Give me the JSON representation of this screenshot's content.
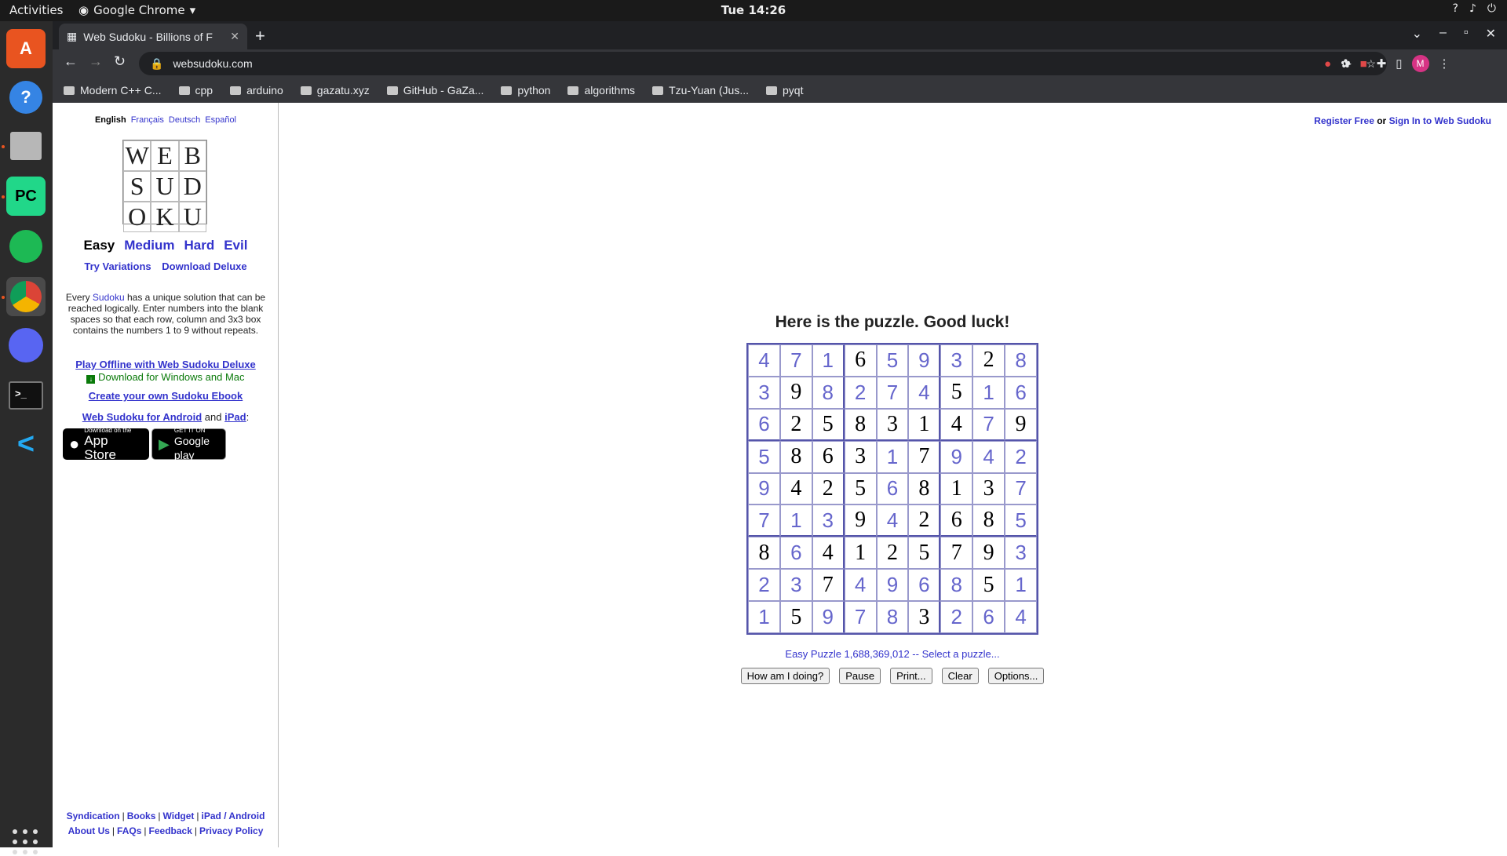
{
  "os": {
    "activities": "Activities",
    "app_menu": "Google Chrome",
    "clock": "Tue 14:26"
  },
  "browser": {
    "tab_title": "Web Sudoku - Billions of F",
    "url": "websudoku.com",
    "bookmarks": [
      "Modern C++ C...",
      "cpp",
      "arduino",
      "gazatu.xyz",
      "GitHub - GaZa...",
      "python",
      "algorithms",
      "Tzu-Yuan (Jus...",
      "pyqt"
    ],
    "profile_initial": "M"
  },
  "left": {
    "languages": [
      "English",
      "Français",
      "Deutsch",
      "Español"
    ],
    "logo_letters": [
      "W",
      "E",
      "B",
      "S",
      "U",
      "D",
      "O",
      "K",
      "U"
    ],
    "levels": [
      "Easy",
      "Medium",
      "Hard",
      "Evil"
    ],
    "try_variations": "Try Variations",
    "download_deluxe": "Download Deluxe",
    "intro_before": "Every",
    "intro_link": "Sudoku",
    "intro_after": "has a unique solution that can be reached logically. Enter numbers into the blank spaces so that each row, column and 3x3 box contains the numbers 1 to 9 without repeats.",
    "play_offline": "Play Offline with Web Sudoku Deluxe",
    "download_note": "Download for Windows and Mac",
    "create_ebook": "Create your own Sudoku Ebook",
    "android_link": "Web Sudoku for Android",
    "and_text": "and",
    "ipad_link": "iPad",
    "colon": ":",
    "appstore_small": "Download on the",
    "appstore_big": "App Store",
    "gplay_small": "GET IT ON",
    "gplay_big": "Google play",
    "footer_row1": [
      "Syndication",
      "Books",
      "Widget",
      "iPad / Android"
    ],
    "footer_row2": [
      "About Us",
      "FAQs",
      "Feedback",
      "Privacy Policy"
    ],
    "footer_sep": "|"
  },
  "header": {
    "register": "Register Free",
    "or": "or",
    "signin": "Sign In to Web Sudoku"
  },
  "main": {
    "title": "Here is the puzzle. Good luck!",
    "puzzle_info": "Easy Puzzle 1,688,369,012 -- Select a puzzle...",
    "buttons": [
      "How am I doing?",
      "Pause",
      "Print...",
      "Clear",
      "Options..."
    ]
  },
  "sudoku": {
    "values": [
      [
        4,
        7,
        1,
        6,
        5,
        9,
        3,
        2,
        8
      ],
      [
        3,
        9,
        8,
        2,
        7,
        4,
        5,
        1,
        6
      ],
      [
        6,
        2,
        5,
        8,
        3,
        1,
        4,
        7,
        9
      ],
      [
        5,
        8,
        6,
        3,
        1,
        7,
        9,
        4,
        2
      ],
      [
        9,
        4,
        2,
        5,
        6,
        8,
        1,
        3,
        7
      ],
      [
        7,
        1,
        3,
        9,
        4,
        2,
        6,
        8,
        5
      ],
      [
        8,
        6,
        4,
        1,
        2,
        5,
        7,
        9,
        3
      ],
      [
        2,
        3,
        7,
        4,
        9,
        6,
        8,
        5,
        1
      ],
      [
        1,
        5,
        9,
        7,
        8,
        3,
        2,
        6,
        4
      ]
    ],
    "given": [
      [
        0,
        0,
        0,
        1,
        0,
        0,
        0,
        1,
        0
      ],
      [
        0,
        1,
        0,
        0,
        0,
        0,
        1,
        0,
        0
      ],
      [
        0,
        1,
        1,
        1,
        1,
        1,
        1,
        0,
        1
      ],
      [
        0,
        1,
        1,
        1,
        0,
        1,
        0,
        0,
        0
      ],
      [
        0,
        1,
        1,
        1,
        0,
        1,
        1,
        1,
        0
      ],
      [
        0,
        0,
        0,
        1,
        0,
        1,
        1,
        1,
        0
      ],
      [
        1,
        0,
        1,
        1,
        1,
        1,
        1,
        1,
        0
      ],
      [
        0,
        0,
        1,
        0,
        0,
        0,
        0,
        1,
        0
      ],
      [
        0,
        1,
        0,
        0,
        0,
        1,
        0,
        0,
        0
      ]
    ]
  }
}
